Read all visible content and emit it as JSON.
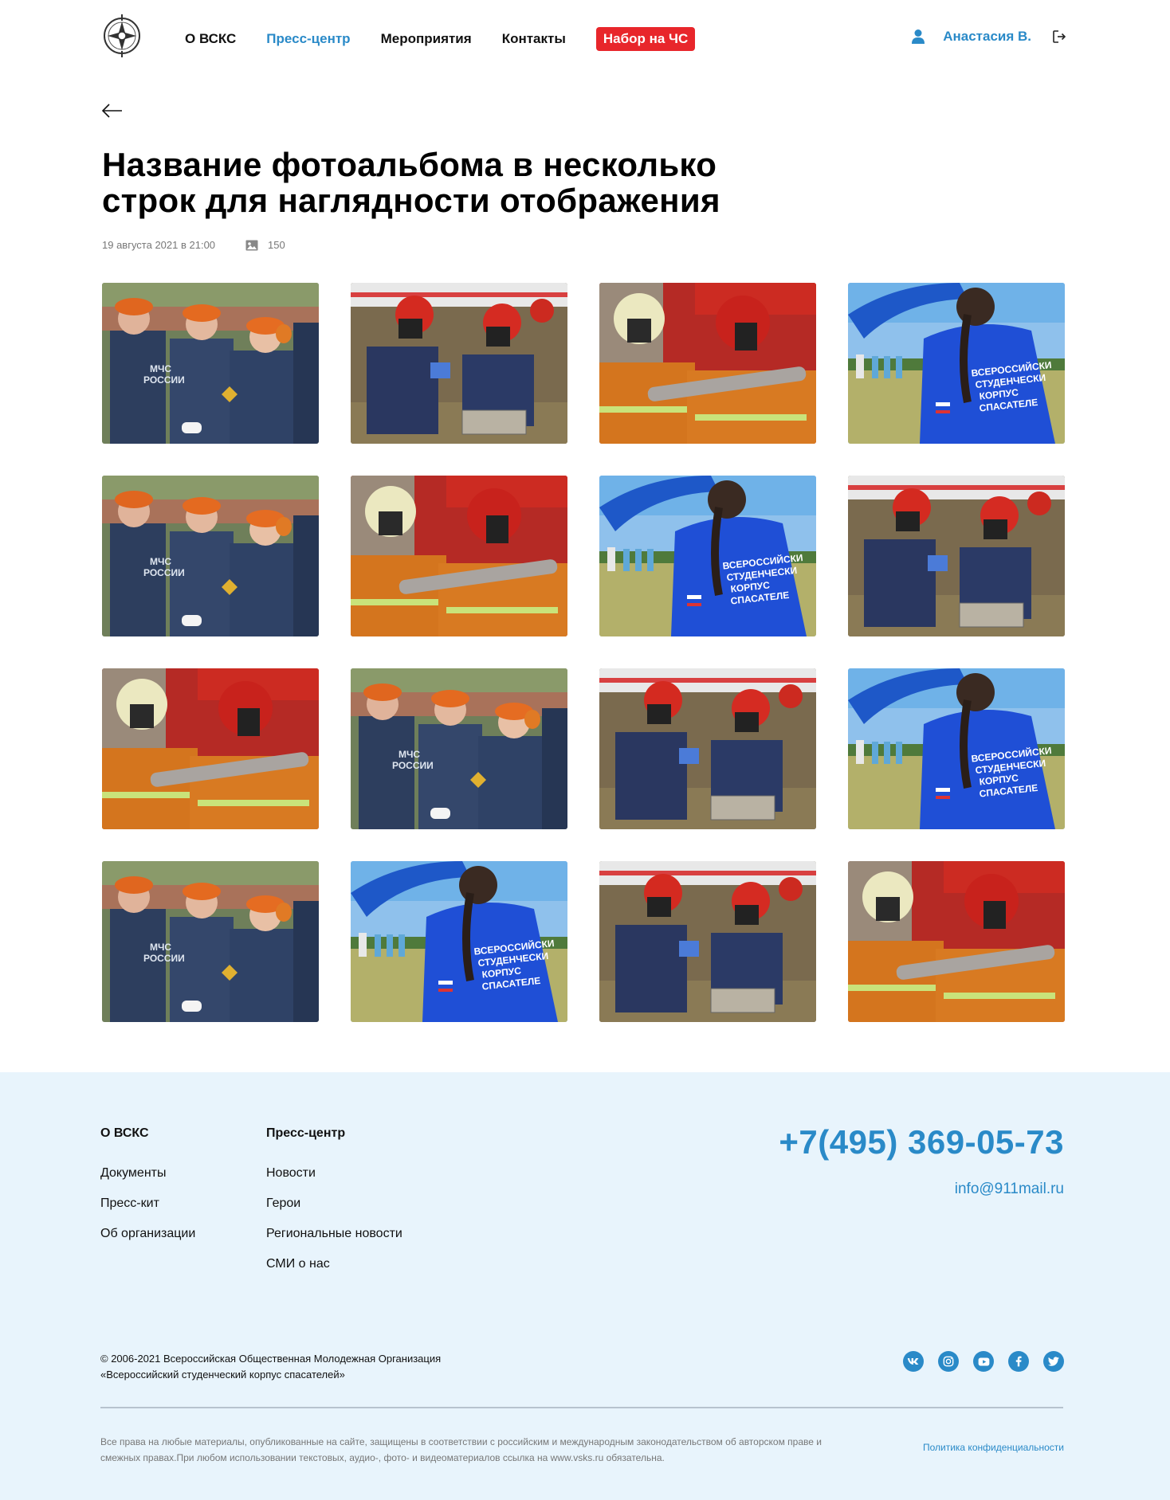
{
  "header": {
    "nav": [
      {
        "label": "О ВСКС"
      },
      {
        "label": "Пресс-центр"
      },
      {
        "label": "Мероприятия"
      },
      {
        "label": "Контакты"
      },
      {
        "label": "Набор на ЧС"
      }
    ],
    "user_name": "Анастасия В."
  },
  "album": {
    "title_line1": "Название фотоальбома в несколько",
    "title_line2": "строк для наглядности отображения",
    "date": "19 августа 2021 в 21:00",
    "photo_count": "150"
  },
  "gallery": {
    "photos": [
      "parade",
      "rescuers",
      "firefighters",
      "volunteer",
      "parade",
      "firefighters",
      "volunteer",
      "rescuers",
      "firefighters",
      "parade",
      "rescuers",
      "volunteer",
      "parade",
      "volunteer",
      "rescuers",
      "firefighters"
    ]
  },
  "footer": {
    "col1": {
      "heading": "О ВСКС",
      "links": [
        "Документы",
        "Пресс-кит",
        "Об организации"
      ]
    },
    "col2": {
      "heading": "Пресс-центр",
      "links": [
        "Новости",
        "Герои",
        "Региональные новости",
        "СМИ о нас"
      ]
    },
    "phone": "+7(495) 369-05-73",
    "email": "info@911mail.ru",
    "copyright_line1": "© 2006-2021 Всероссийская Общественная Молодежная Организация",
    "copyright_line2": "«Всероссийский студенческий корпус спасателей»",
    "socials": [
      "vk-icon",
      "instagram-icon",
      "youtube-icon",
      "facebook-icon",
      "twitter-icon"
    ],
    "legal_line1": "Все права на любые материалы, опубликованные на сайте, защищены в соответствии с российским и международным законодательством об авторском праве и",
    "legal_line2": "смежных правах.При любом использовании текстовых, аудио-, фото- и видеоматериалов ссылка на www.vsks.ru обязательна.",
    "privacy": "Политика конфиденциальности"
  },
  "colors": {
    "accent": "#2a8ac8",
    "badge": "#e8262b",
    "footer_bg": "#e8f4fc"
  }
}
